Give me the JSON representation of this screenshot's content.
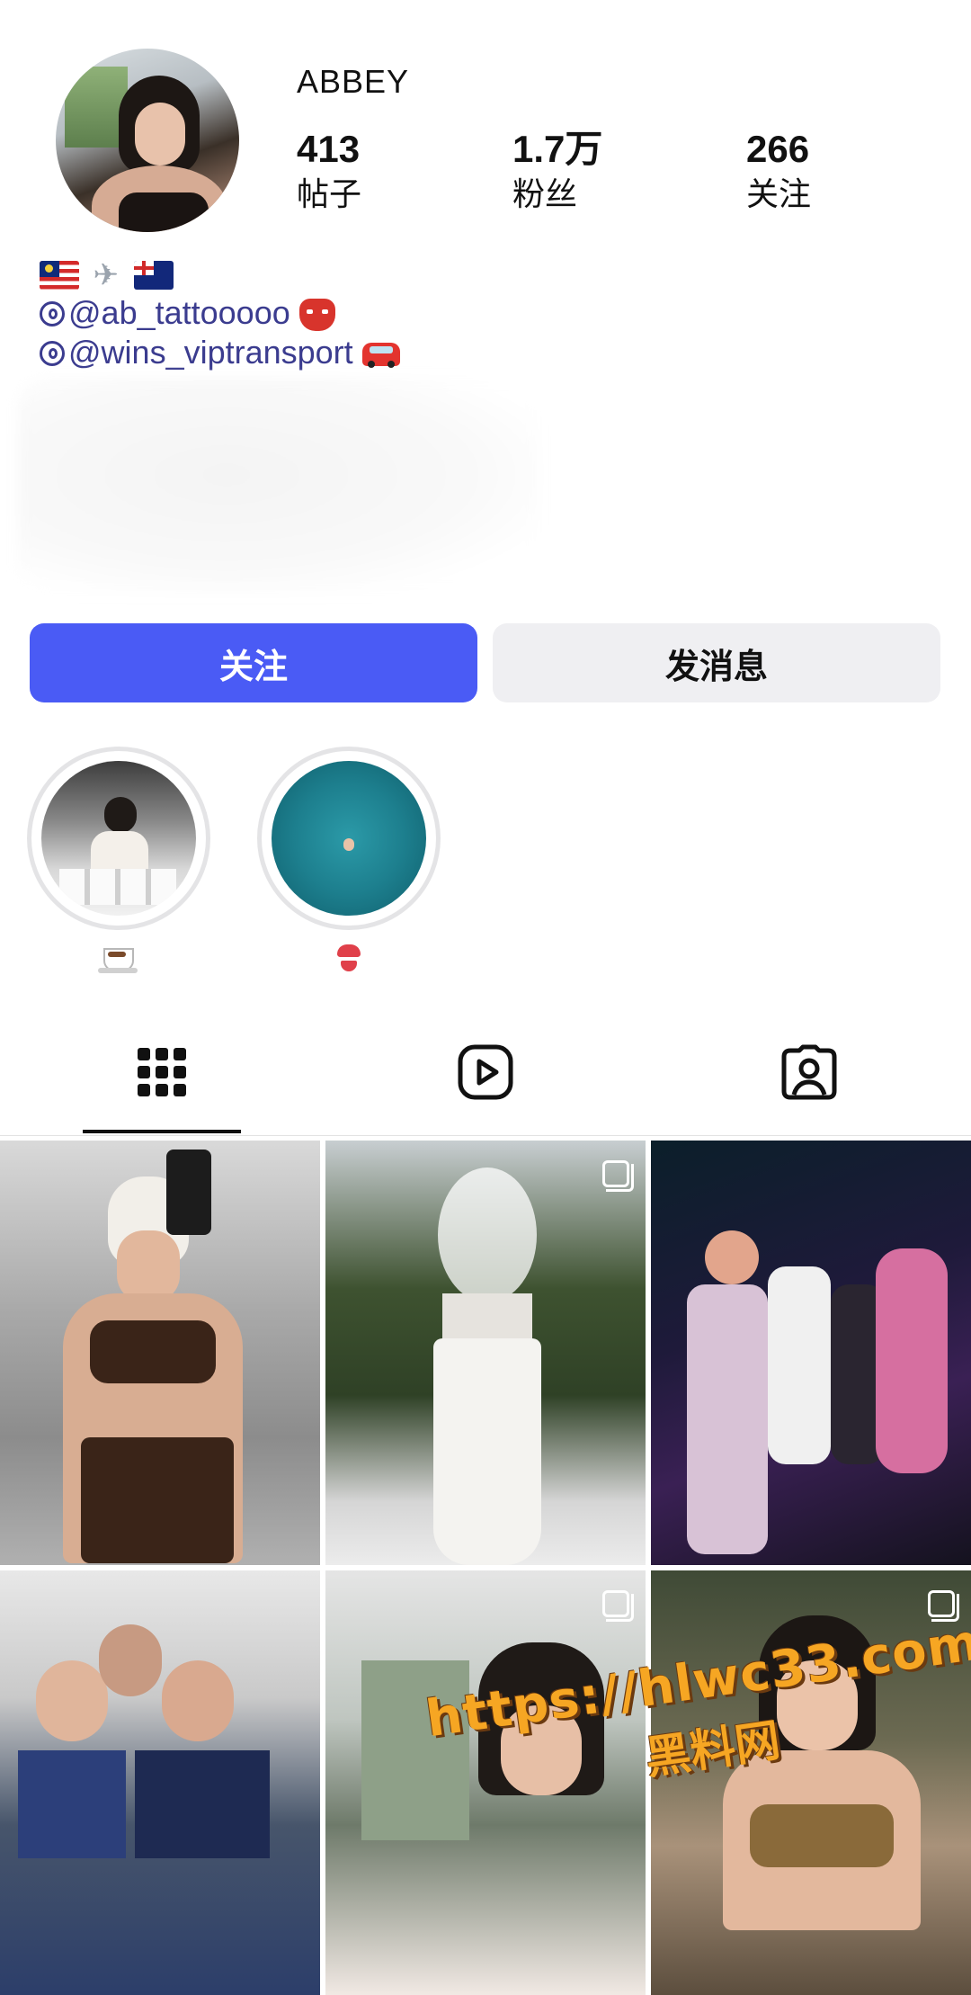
{
  "profile": {
    "username": "ABBEY",
    "stats": [
      {
        "value": "413",
        "label": "帖子"
      },
      {
        "value": "1.7万",
        "label": "粉丝"
      },
      {
        "value": "266",
        "label": "关注"
      }
    ],
    "handles": [
      {
        "text": "@ab_tattooooo",
        "emoji": "mask-emoji"
      },
      {
        "text": "@wins_viptransport",
        "emoji": "car-emoji"
      }
    ],
    "flags": [
      "malaysia-flag-icon",
      "airplane-icon",
      "australia-flag-icon"
    ]
  },
  "actions": {
    "follow_label": "关注",
    "message_label": "发消息",
    "follow_color": "#4a5bf5"
  },
  "highlights": [
    {
      "name": "coffee-highlight",
      "emoji": "hot-beverage-icon"
    },
    {
      "name": "sea-highlight",
      "emoji": "bikini-icon"
    }
  ],
  "tabs": [
    {
      "name": "tab-grid",
      "icon": "grid-icon",
      "active": true
    },
    {
      "name": "tab-reels",
      "icon": "reels-icon",
      "active": false
    },
    {
      "name": "tab-tagged",
      "icon": "tagged-icon",
      "active": false
    }
  ],
  "posts": [
    {
      "name": "post-1",
      "multi": false
    },
    {
      "name": "post-2",
      "multi": true
    },
    {
      "name": "post-3",
      "multi": false
    },
    {
      "name": "post-4",
      "multi": false
    },
    {
      "name": "post-5",
      "multi": true
    },
    {
      "name": "post-6",
      "multi": true
    }
  ],
  "watermark": {
    "line1": "https://hlwc33.com",
    "line2": "黑料网"
  }
}
